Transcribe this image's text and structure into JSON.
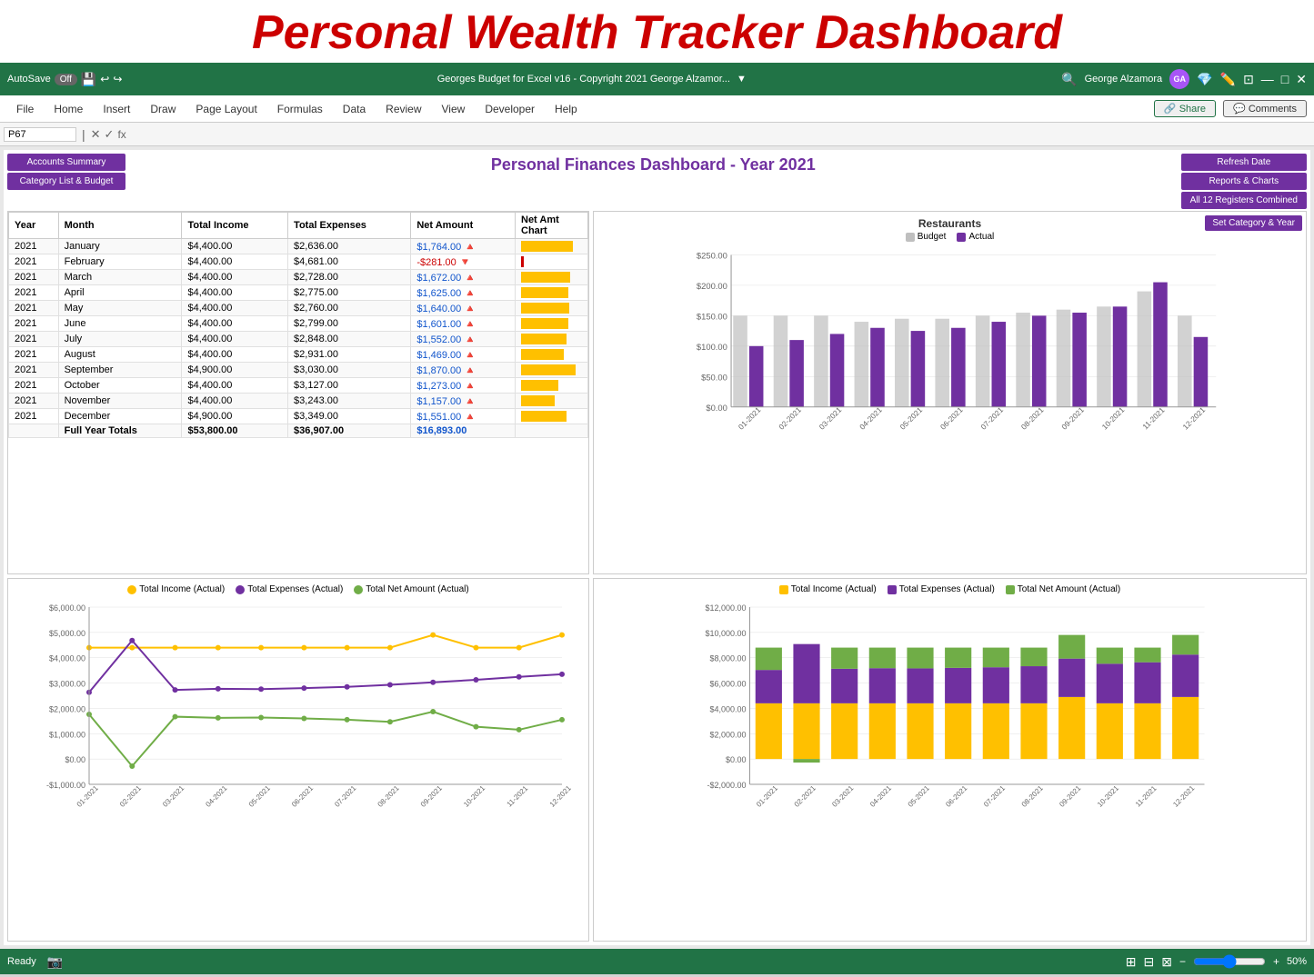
{
  "title": "Personal Wealth Tracker Dashboard",
  "ribbon": {
    "autosave": "AutoSave",
    "off": "Off",
    "file_title": "Georges Budget for Excel v16 - Copyright 2021 George Alzamor...",
    "user_name": "George Alzamora",
    "user_initials": "GA"
  },
  "menu": {
    "items": [
      "File",
      "Home",
      "Insert",
      "Draw",
      "Page Layout",
      "Formulas",
      "Data",
      "Review",
      "View",
      "Developer",
      "Help"
    ],
    "share": "Share",
    "comments": "Comments"
  },
  "formula_bar": {
    "cell_ref": "P67",
    "formula": ""
  },
  "dashboard": {
    "title": "Personal Finances Dashboard - Year 2021",
    "buttons": {
      "accounts_summary": "Accounts Summary",
      "category_list": "Category List & Budget",
      "refresh_date": "Refresh Date",
      "reports_charts": "Reports & Charts",
      "all_registers": "All 12 Registers Combined",
      "set_category": "Set Category & Year"
    }
  },
  "table": {
    "headers": [
      "Year",
      "Month",
      "Total Income",
      "Total Expenses",
      "Net Amount",
      "Net Amt Chart"
    ],
    "rows": [
      {
        "year": "2021",
        "month": "January",
        "income": "$4,400.00",
        "expenses": "$2,636.00",
        "net": "$1,764.00",
        "positive": true,
        "bar_pct": 85
      },
      {
        "year": "2021",
        "month": "February",
        "income": "$4,400.00",
        "expenses": "$4,681.00",
        "net": "-$281.00",
        "positive": false,
        "bar_pct": 5
      },
      {
        "year": "2021",
        "month": "March",
        "income": "$4,400.00",
        "expenses": "$2,728.00",
        "net": "$1,672.00",
        "positive": true,
        "bar_pct": 80
      },
      {
        "year": "2021",
        "month": "April",
        "income": "$4,400.00",
        "expenses": "$2,775.00",
        "net": "$1,625.00",
        "positive": true,
        "bar_pct": 78
      },
      {
        "year": "2021",
        "month": "May",
        "income": "$4,400.00",
        "expenses": "$2,760.00",
        "net": "$1,640.00",
        "positive": true,
        "bar_pct": 79
      },
      {
        "year": "2021",
        "month": "June",
        "income": "$4,400.00",
        "expenses": "$2,799.00",
        "net": "$1,601.00",
        "positive": true,
        "bar_pct": 77
      },
      {
        "year": "2021",
        "month": "July",
        "income": "$4,400.00",
        "expenses": "$2,848.00",
        "net": "$1,552.00",
        "positive": true,
        "bar_pct": 74
      },
      {
        "year": "2021",
        "month": "August",
        "income": "$4,400.00",
        "expenses": "$2,931.00",
        "net": "$1,469.00",
        "positive": true,
        "bar_pct": 70
      },
      {
        "year": "2021",
        "month": "September",
        "income": "$4,900.00",
        "expenses": "$3,030.00",
        "net": "$1,870.00",
        "positive": true,
        "bar_pct": 90
      },
      {
        "year": "2021",
        "month": "October",
        "income": "$4,400.00",
        "expenses": "$3,127.00",
        "net": "$1,273.00",
        "positive": true,
        "bar_pct": 61
      },
      {
        "year": "2021",
        "month": "November",
        "income": "$4,400.00",
        "expenses": "$3,243.00",
        "net": "$1,157.00",
        "positive": true,
        "bar_pct": 55
      },
      {
        "year": "2021",
        "month": "December",
        "income": "$4,900.00",
        "expenses": "$3,349.00",
        "net": "$1,551.00",
        "positive": true,
        "bar_pct": 74
      }
    ],
    "totals": {
      "label": "Full Year Totals",
      "income": "$53,800.00",
      "expenses": "$36,907.00",
      "net": "$16,893.00"
    }
  },
  "restaurants_chart": {
    "title": "Restaurants",
    "legend": [
      {
        "label": "Budget",
        "color": "#bfbfbf"
      },
      {
        "label": "Actual",
        "color": "#7030a0"
      }
    ],
    "months": [
      "01-2021",
      "02-2021",
      "03-2021",
      "04-2021",
      "05-2021",
      "06-2021",
      "07-2021",
      "08-2021",
      "09-2021",
      "10-2021",
      "11-2021",
      "12-2021"
    ],
    "budget": [
      150,
      150,
      150,
      140,
      145,
      145,
      150,
      155,
      160,
      165,
      190,
      150
    ],
    "actual": [
      100,
      110,
      120,
      130,
      125,
      130,
      140,
      150,
      155,
      165,
      205,
      115
    ],
    "y_max": 250,
    "y_labels": [
      "$250.00",
      "$200.00",
      "$150.00",
      "$100.00",
      "$50.00",
      "$0.00"
    ]
  },
  "line_chart": {
    "legend": [
      {
        "label": "Total Income (Actual)",
        "color": "#ffc000"
      },
      {
        "label": "Total Expenses (Actual)",
        "color": "#7030a0"
      },
      {
        "label": "Total Net Amount (Actual)",
        "color": "#70ad47"
      }
    ],
    "months": [
      "01-2021",
      "02-2021",
      "03-2021",
      "04-2021",
      "05-2021",
      "06-2021",
      "07-2021",
      "08-2021",
      "09-2021",
      "10-2021",
      "11-2021",
      "12-2021"
    ],
    "income": [
      4400,
      4400,
      4400,
      4400,
      4400,
      4400,
      4400,
      4400,
      4900,
      4400,
      4400,
      4900
    ],
    "expenses": [
      2636,
      4681,
      2728,
      2775,
      2760,
      2799,
      2848,
      2931,
      3030,
      3127,
      3243,
      3349
    ],
    "net": [
      1764,
      -281,
      1672,
      1625,
      1640,
      1601,
      1552,
      1469,
      1870,
      1273,
      1157,
      1551
    ],
    "y_labels": [
      "$6,000.00",
      "$5,000.00",
      "$4,000.00",
      "$3,000.00",
      "$2,000.00",
      "$1,000.00",
      "$0.00",
      "-$1,000.00"
    ]
  },
  "stacked_chart": {
    "legend": [
      {
        "label": "Total Income (Actual)",
        "color": "#ffc000"
      },
      {
        "label": "Total Expenses (Actual)",
        "color": "#7030a0"
      },
      {
        "label": "Total Net Amount (Actual)",
        "color": "#70ad47"
      }
    ],
    "months": [
      "01-2021",
      "02-2021",
      "03-2021",
      "04-2021",
      "05-2021",
      "06-2021",
      "07-2021",
      "08-2021",
      "09-2021",
      "10-2021",
      "11-2021",
      "12-2021"
    ],
    "income": [
      4400,
      4400,
      4400,
      4400,
      4400,
      4400,
      4400,
      4400,
      4900,
      4400,
      4400,
      4900
    ],
    "expenses": [
      2636,
      4681,
      2728,
      2775,
      2760,
      2799,
      2848,
      2931,
      3030,
      3127,
      3243,
      3349
    ],
    "net": [
      1764,
      -281,
      1672,
      1625,
      1640,
      1601,
      1552,
      1469,
      1870,
      1273,
      1157,
      1551
    ],
    "y_labels": [
      "$12,000.00",
      "$10,000.00",
      "$8,000.00",
      "$6,000.00",
      "$4,000.00",
      "$2,000.00",
      "$0.00",
      "-$2,000.00"
    ]
  },
  "status": {
    "ready": "Ready",
    "zoom": "50%"
  }
}
